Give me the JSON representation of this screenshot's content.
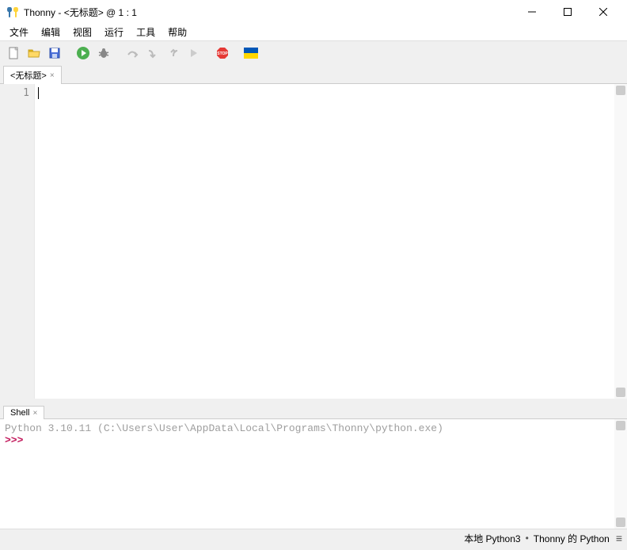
{
  "titlebar": {
    "title": "Thonny  -  <无标题>  @  1 : 1"
  },
  "menubar": {
    "items": [
      "文件",
      "编辑",
      "视图",
      "运行",
      "工具",
      "帮助"
    ]
  },
  "toolbar": {
    "new": "new-file",
    "open": "open-file",
    "save": "save-file",
    "run": "run",
    "debug": "debug",
    "step_over": "step-over",
    "step_into": "step-into",
    "step_out": "step-out",
    "resume": "resume",
    "stop": "stop",
    "flag": "ukraine-flag"
  },
  "editor": {
    "tab_label": "<无标题>",
    "line_number": "1",
    "content": ""
  },
  "shell": {
    "tab_label": "Shell",
    "version_line": "Python 3.10.11 (C:\\Users\\User\\AppData\\Local\\Programs\\Thonny\\python.exe)",
    "prompt": ">>>"
  },
  "statusbar": {
    "left": "本地 Python3",
    "right": "Thonny 的 Python"
  }
}
